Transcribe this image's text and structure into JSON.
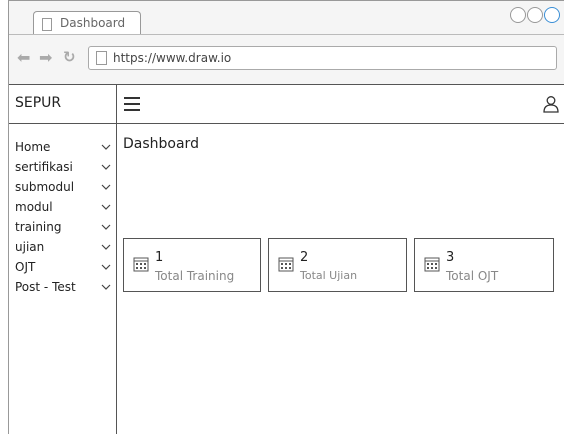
{
  "browser": {
    "tab_title": "Dashboard",
    "url": "https://www.draw.io"
  },
  "app": {
    "brand": "SEPUR",
    "page_title": "Dashboard"
  },
  "sidebar": {
    "items": [
      {
        "label": "Home"
      },
      {
        "label": "sertifikasi"
      },
      {
        "label": "submodul"
      },
      {
        "label": "modul"
      },
      {
        "label": "training"
      },
      {
        "label": "ujian"
      },
      {
        "label": "OJT"
      },
      {
        "label": "Post - Test"
      }
    ]
  },
  "cards": [
    {
      "number": "1",
      "label": "Total Training"
    },
    {
      "number": "2",
      "label": "Total Ujian"
    },
    {
      "number": "3",
      "label": "Total OJT"
    }
  ],
  "colors": {
    "border": "#555555",
    "chrome_bg": "#f5f5f5",
    "accent_blue": "#3b8fd6",
    "muted_text": "#888888"
  },
  "icons": {
    "menu": "hamburger-menu-icon",
    "user": "user-icon",
    "card": "calendar-icon",
    "chevron": "chevron-down-icon"
  }
}
